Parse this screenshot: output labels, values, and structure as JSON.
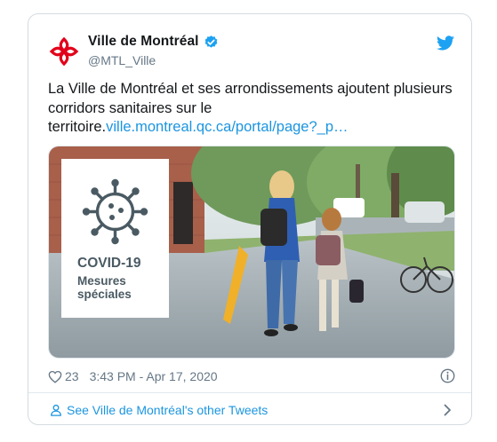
{
  "author": {
    "display_name": "Ville de Montréal",
    "handle": "@MTL_Ville",
    "verified": true,
    "brand_color": "#e2001a"
  },
  "tweet": {
    "text_lead": "La Ville de Montréal et ses arrondissements ajoutent plusieurs corridors sanitaires sur le territoire.",
    "link_text": "ville.montreal.qc.ca/portal/page?_p…"
  },
  "media": {
    "overlay_title": "COVID-19",
    "overlay_subtitle": "Mesures spéciales"
  },
  "meta": {
    "like_count": "23",
    "timestamp": "3:43 PM - Apr 17, 2020"
  },
  "footer": {
    "other_tweets_label": "See Ville de Montréal's other Tweets"
  },
  "colors": {
    "link": "#1b95e0",
    "twitter_blue": "#1da1f2",
    "secondary_text": "#657786",
    "border": "#d4dbe0"
  },
  "icons": [
    "montreal-logo-icon",
    "verified-badge-icon",
    "twitter-bird-icon",
    "virus-icon",
    "heart-icon",
    "info-icon",
    "person-icon",
    "chevron-right-icon"
  ]
}
